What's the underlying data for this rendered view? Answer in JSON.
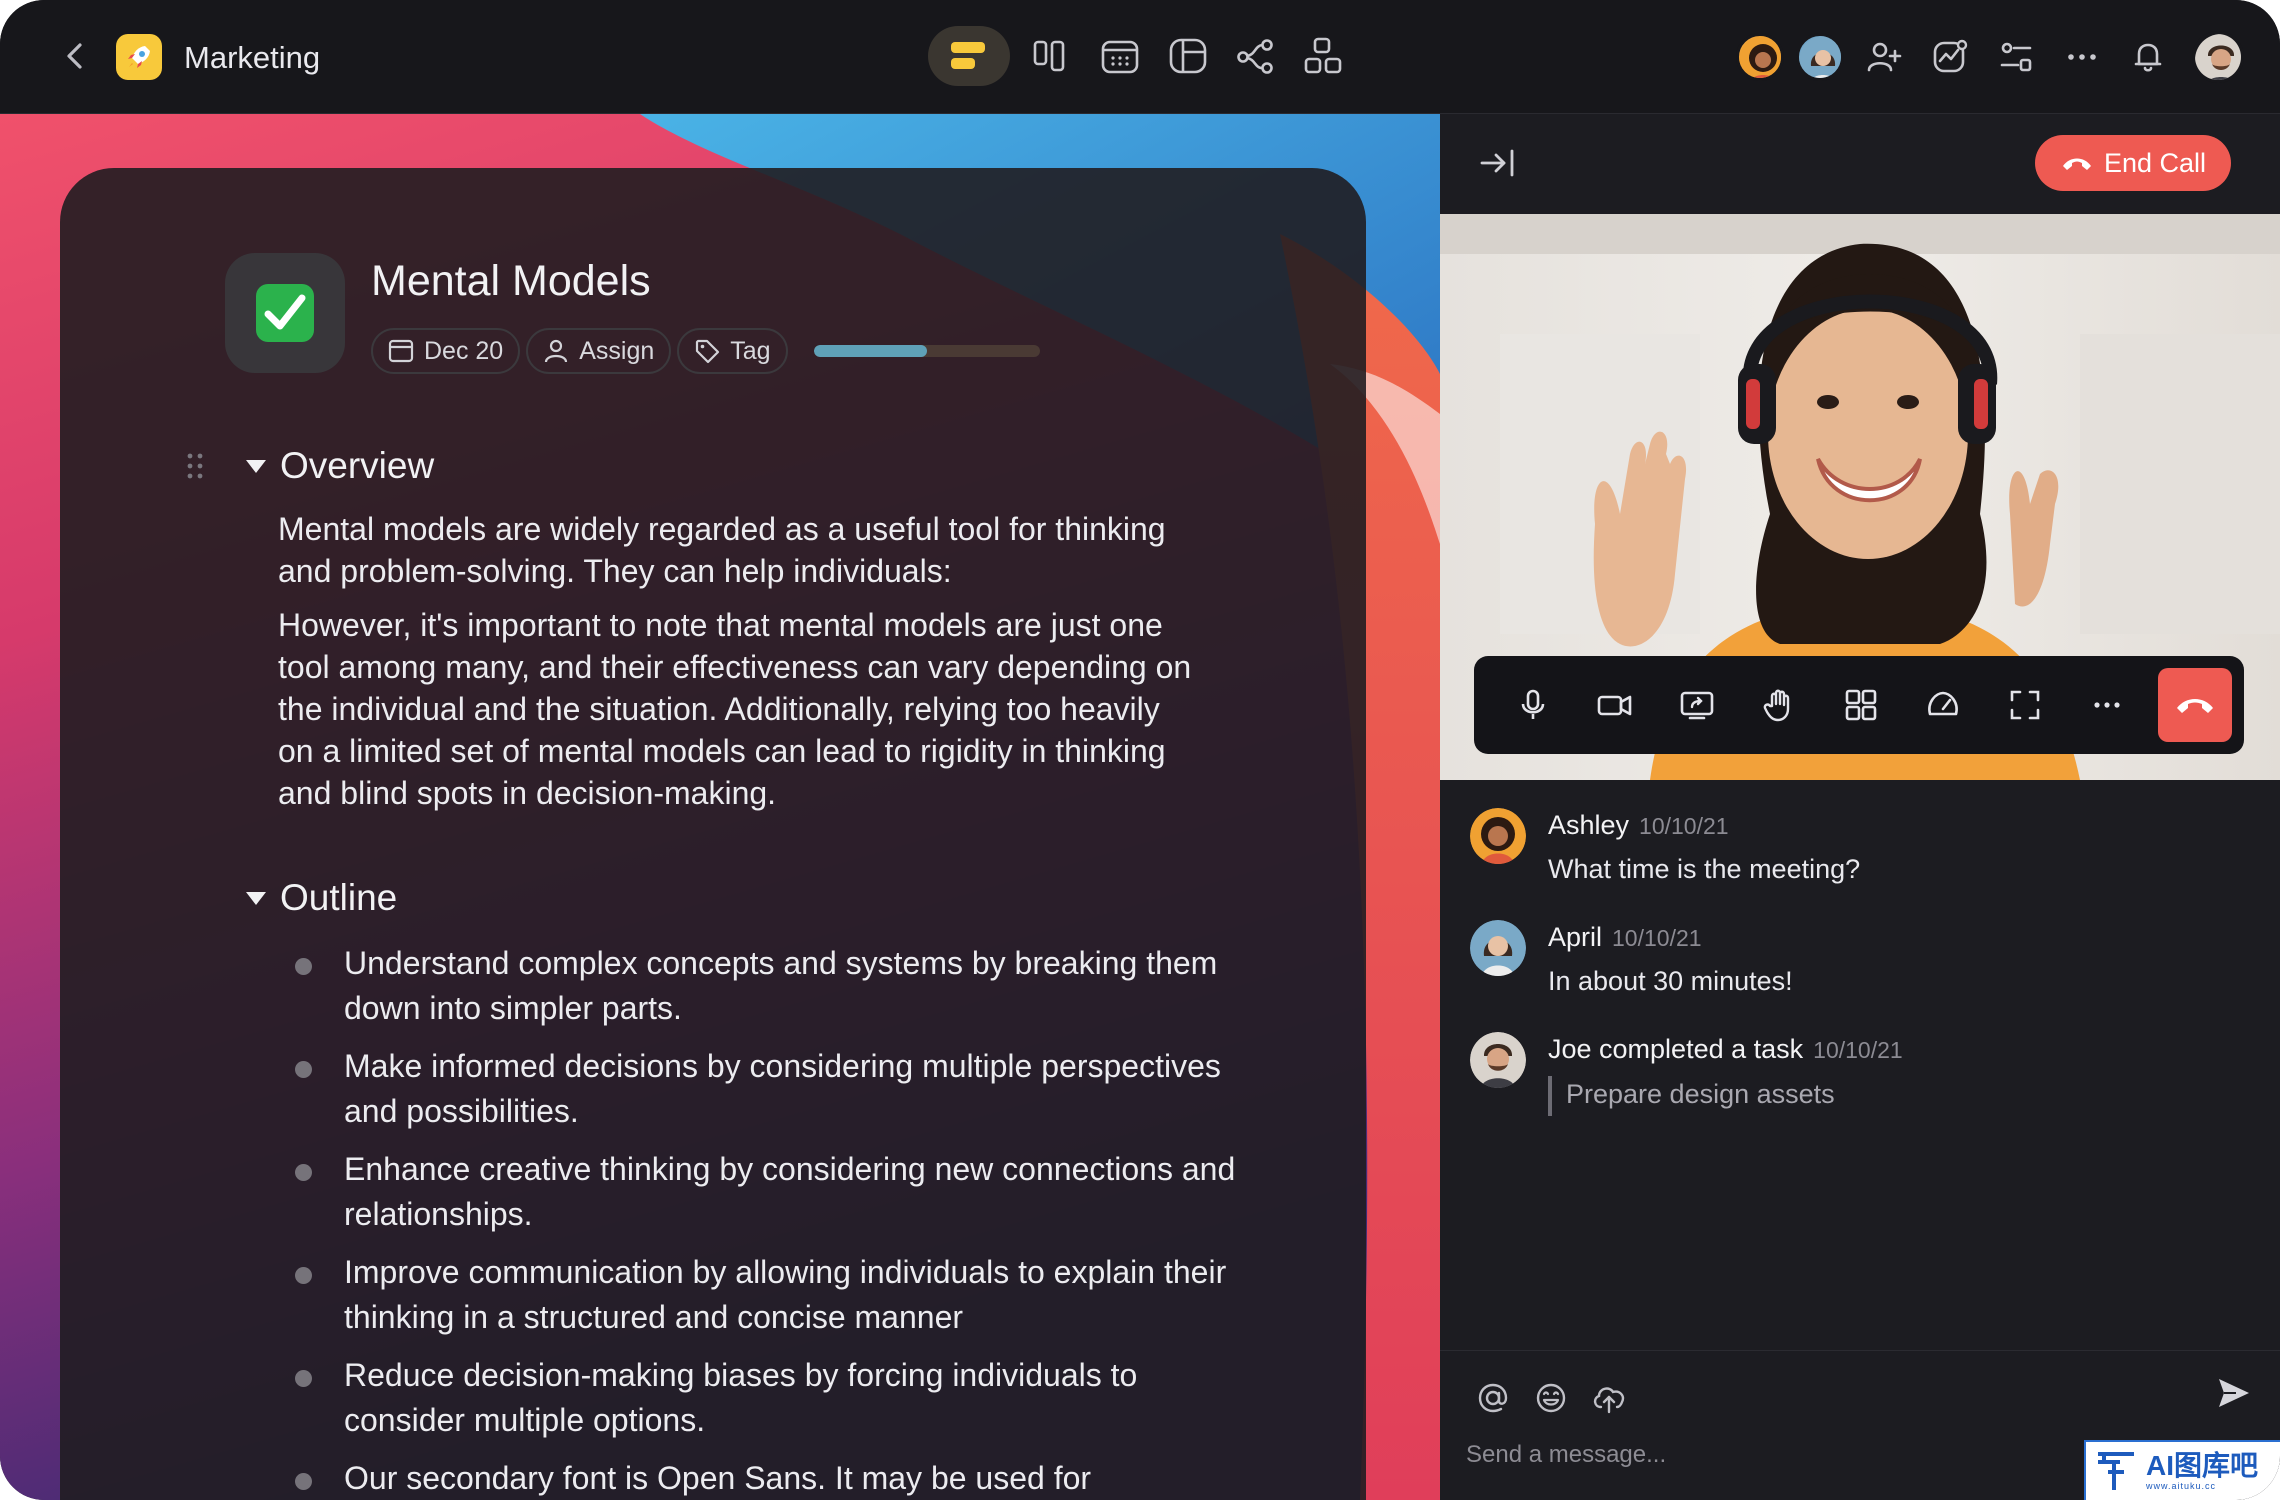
{
  "header": {
    "title": "Marketing",
    "app_icon": "rocket-icon",
    "view_icons": [
      "board-view-icon",
      "columns-view-icon",
      "calendar-view-icon",
      "table-view-icon",
      "mindmap-view-icon",
      "hierarchy-view-icon"
    ],
    "action_icons": [
      "add-member-icon",
      "activity-icon",
      "filter-settings-icon",
      "more-icon",
      "bell-icon"
    ]
  },
  "document": {
    "icon": "check-mark-icon",
    "title": "Mental Models",
    "date_chip": "Dec 20",
    "assign_chip": "Assign",
    "tag_chip": "Tag",
    "progress": 0.5,
    "sections": {
      "overview": {
        "heading": "Overview",
        "paragraph_1": "Mental models are widely regarded as a useful tool for thinking and problem-solving. They can help individuals:",
        "paragraph_2": "However, it's important to note that mental models are just one tool among many, and their effectiveness can vary depending on the individual and the situation. Additionally, relying too heavily on a limited set of mental models can lead to rigidity in thinking and blind spots in decision-making."
      },
      "outline": {
        "heading": "Outline",
        "items": [
          "Understand complex concepts and systems by breaking them down into simpler parts.",
          "Make informed decisions by considering multiple perspectives and possibilities.",
          "Enhance creative thinking by considering new connections and relationships.",
          "Improve communication by allowing individuals to explain their thinking in a structured and concise manner",
          "Reduce decision-making biases by forcing individuals to consider multiple options.",
          "Our secondary font is Open Sans. It may be used for"
        ]
      }
    }
  },
  "call": {
    "end_call_label": "End Call",
    "controls": [
      "microphone-icon",
      "camera-icon",
      "screen-share-icon",
      "raise-hand-icon",
      "grid-layout-icon",
      "speed-gauge-icon",
      "fullscreen-icon",
      "more-icon",
      "hang-up-icon"
    ]
  },
  "chat": {
    "messages": [
      {
        "author": "Ashley",
        "time": "10/10/21",
        "text": "What time is the meeting?"
      },
      {
        "author": "April",
        "time": "10/10/21",
        "text": "In about 30 minutes!"
      },
      {
        "author": "Joe completed a task",
        "time": "10/10/21",
        "task": "Prepare design assets"
      }
    ],
    "composer_placeholder": "Send a message...",
    "composer_icons": [
      "mention-icon",
      "emoji-icon",
      "upload-icon",
      "send-icon"
    ]
  },
  "watermark": {
    "text": "AI图库吧",
    "sub": "www.aituku.cc"
  },
  "colors": {
    "accent_yellow": "#f8c93b",
    "end_call_red": "#ee5a52",
    "progress_blue": "#5fa1b8",
    "panel_bg": "#1c1c21"
  }
}
